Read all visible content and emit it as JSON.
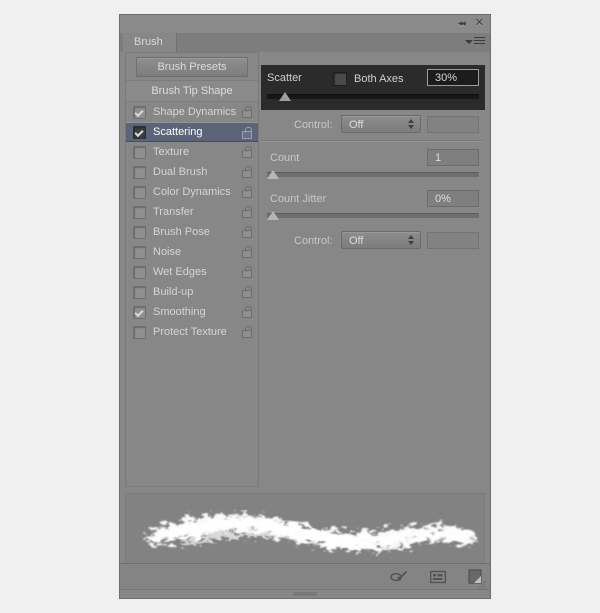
{
  "panel": {
    "title": "Brush",
    "tab_label": "Brush",
    "collapse_icon": "collapse-icon",
    "close_icon": "close-icon",
    "menu_icon": "panel-menu-icon"
  },
  "sidebar": {
    "presets_button": "Brush Presets",
    "section_header": "Brush Tip Shape",
    "items": [
      {
        "label": "Shape Dynamics",
        "checked": true,
        "selected": false,
        "locked": true
      },
      {
        "label": "Scattering",
        "checked": true,
        "selected": true,
        "locked": true
      },
      {
        "label": "Texture",
        "checked": false,
        "selected": false,
        "locked": true
      },
      {
        "label": "Dual Brush",
        "checked": false,
        "selected": false,
        "locked": true
      },
      {
        "label": "Color Dynamics",
        "checked": false,
        "selected": false,
        "locked": true
      },
      {
        "label": "Transfer",
        "checked": false,
        "selected": false,
        "locked": true
      },
      {
        "label": "Brush Pose",
        "checked": false,
        "selected": false,
        "locked": true
      },
      {
        "label": "Noise",
        "checked": false,
        "selected": false,
        "locked": true
      },
      {
        "label": "Wet Edges",
        "checked": false,
        "selected": false,
        "locked": true
      },
      {
        "label": "Build-up",
        "checked": false,
        "selected": false,
        "locked": true
      },
      {
        "label": "Smoothing",
        "checked": true,
        "selected": false,
        "locked": true
      },
      {
        "label": "Protect Texture",
        "checked": false,
        "selected": false,
        "locked": true
      }
    ]
  },
  "scattering": {
    "scatter": {
      "label": "Scatter",
      "both_axes_label": "Both Axes",
      "both_axes_checked": false,
      "value": "30%",
      "slider_percent": 6
    },
    "scatter_control": {
      "label": "Control:",
      "value": "Off"
    },
    "count": {
      "label": "Count",
      "value": "1",
      "slider_percent": 0
    },
    "count_jitter": {
      "label": "Count Jitter",
      "value": "0%",
      "slider_percent": 0
    },
    "count_jitter_control": {
      "label": "Control:",
      "value": "Off"
    }
  },
  "footer": {
    "icons": [
      "brush-preview-icon",
      "toggle-brush-panels-icon",
      "new-brush-icon"
    ],
    "resize_grip": "resize-grip-icon"
  },
  "preview": {
    "label": "brush-stroke-preview"
  },
  "colors": {
    "panel_bg": "#878787",
    "highlight_row": "#5c6577",
    "dark_section": "#2b2b2b",
    "text": "#d5d5d5"
  }
}
